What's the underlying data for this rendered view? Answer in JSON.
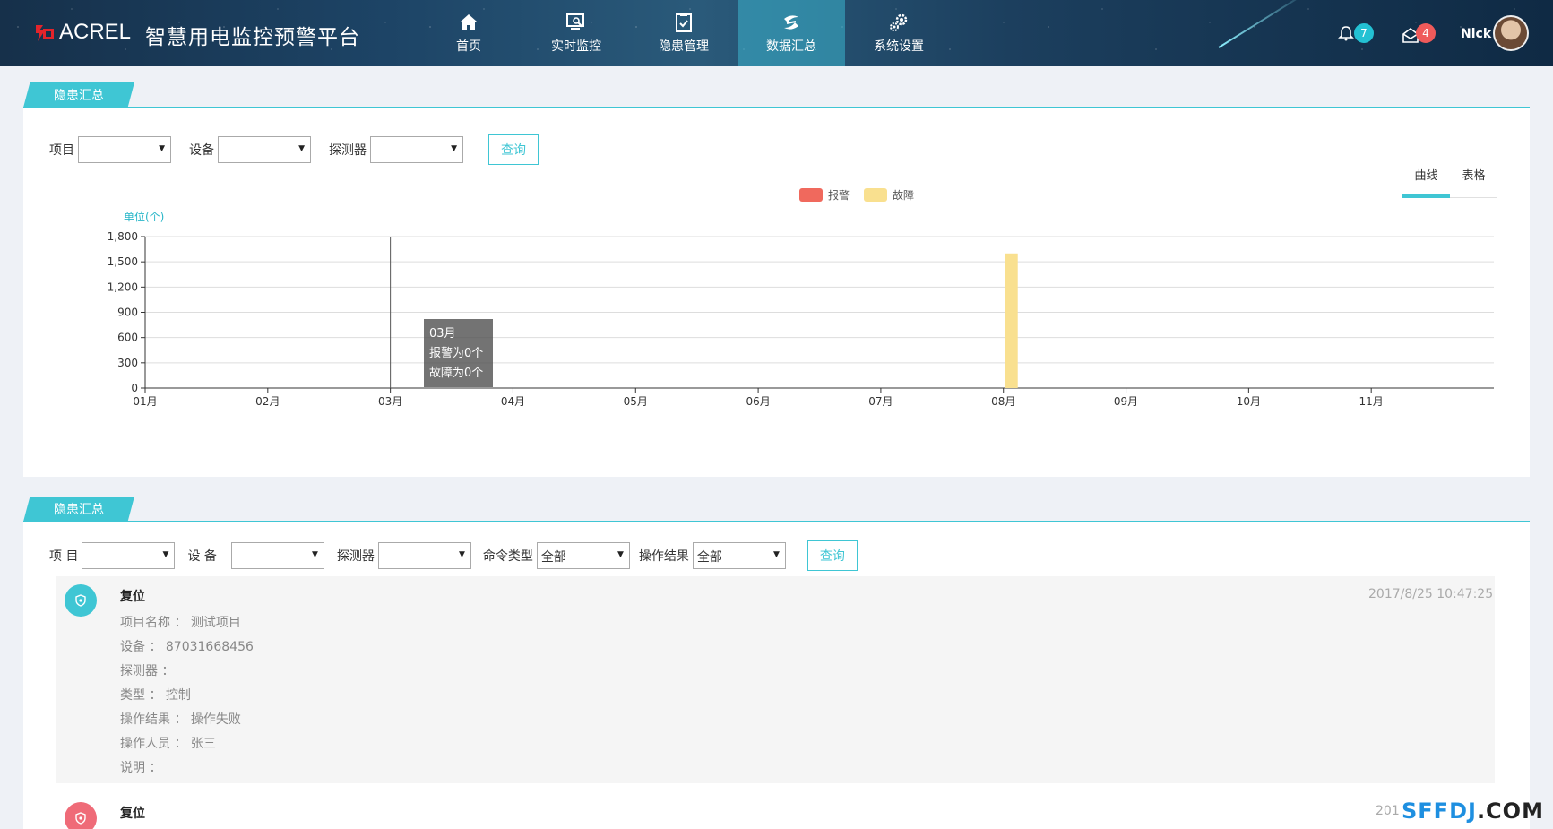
{
  "header": {
    "logo_text": "ACREL",
    "title": "智慧用电监控预警平台",
    "nav": [
      {
        "label": "首页",
        "icon": "home-icon"
      },
      {
        "label": "实时监控",
        "icon": "monitor-search-icon"
      },
      {
        "label": "隐患管理",
        "icon": "clipboard-check-icon"
      },
      {
        "label": "数据汇总",
        "icon": "data-summary-icon",
        "active": true
      },
      {
        "label": "系统设置",
        "icon": "gears-icon"
      }
    ],
    "notifications": "7",
    "messages": "4",
    "username": "Nick"
  },
  "summary": {
    "section_title": "隐患汇总",
    "filters": {
      "project_label": "项目",
      "project_value": "",
      "device_label": "设备",
      "device_value": "",
      "detector_label": "探测器",
      "detector_value": "",
      "query_label": "查询"
    },
    "view_tabs": [
      {
        "label": "曲线",
        "active": true
      },
      {
        "label": "表格",
        "active": false
      }
    ],
    "legend": [
      {
        "name": "报警",
        "color": "#f0695d"
      },
      {
        "name": "故障",
        "color": "#f9e08f"
      }
    ],
    "tooltip": {
      "title": "03月",
      "line1": "报警为0个",
      "line2": "故障为0个"
    }
  },
  "chart_data": {
    "type": "bar",
    "ylabel": "单位(个)",
    "ylim": [
      0,
      1800
    ],
    "yticks": [
      "0",
      "300",
      "600",
      "900",
      "1,200",
      "1,500",
      "1,800"
    ],
    "categories": [
      "01月",
      "02月",
      "03月",
      "04月",
      "05月",
      "06月",
      "07月",
      "08月",
      "09月",
      "10月",
      "11月"
    ],
    "series": [
      {
        "name": "报警",
        "color": "#f0695d",
        "values": [
          0,
          0,
          0,
          0,
          0,
          0,
          0,
          0,
          0,
          0,
          0
        ]
      },
      {
        "name": "故障",
        "color": "#f9e08f",
        "values": [
          0,
          0,
          0,
          0,
          0,
          0,
          0,
          1600,
          0,
          0,
          0
        ]
      }
    ],
    "grid": true,
    "legend_position": "top-center"
  },
  "records_section": {
    "section_title": "隐患汇总",
    "filters": {
      "project_label": "项 目",
      "project_value": "",
      "device_label": "设 备",
      "device_value": "",
      "detector_label": "探测器",
      "detector_value": "",
      "cmd_type_label": "命令类型",
      "cmd_type_value": "全部",
      "result_label": "操作结果",
      "result_value": "全部",
      "query_label": "查询"
    },
    "records": [
      {
        "title": "复位",
        "time": "2017/8/25 10:47:25",
        "icon_color": "#3fc6d4",
        "fields": [
          "项目名称 ： 测试项目",
          "设备 ： 87031668456",
          "探测器 ：",
          "类型 ： 控制",
          "操作结果 ： 操作失败",
          "操作人员 ： 张三",
          "说明 ："
        ]
      },
      {
        "title": "复位",
        "time": "201",
        "icon_color": "#ef6b78",
        "fields": []
      }
    ]
  },
  "watermark": {
    "part1": "SFFDJ",
    "part2": ".COM"
  }
}
